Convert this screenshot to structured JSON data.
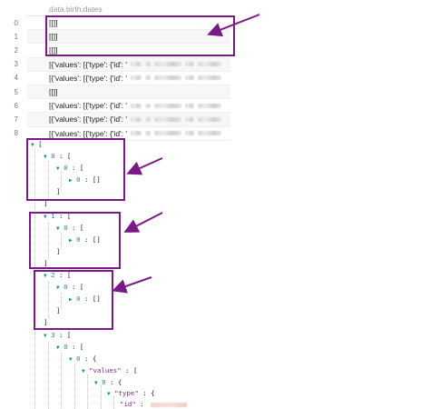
{
  "table": {
    "header": "data.birth.dates",
    "rows": [
      {
        "index": "0",
        "value": "[[]]",
        "blurred": false
      },
      {
        "index": "1",
        "value": "[[]]",
        "blurred": false
      },
      {
        "index": "2",
        "value": "[[]]",
        "blurred": false
      },
      {
        "index": "3",
        "value": "[{'values': [{'type': {'id': '",
        "blurred": true
      },
      {
        "index": "4",
        "value": "[{'values': [{'type': {'id': '",
        "blurred": true
      },
      {
        "index": "5",
        "value": "[[]]",
        "blurred": false
      },
      {
        "index": "6",
        "value": "[{'values': [{'type': {'id': '",
        "blurred": true
      },
      {
        "index": "7",
        "value": "[{'values': [{'type': {'id': '",
        "blurred": true
      },
      {
        "index": "8",
        "value": "[{'values': [{'type': {'id': '",
        "blurred": true
      }
    ]
  },
  "tree": {
    "root_open": "[",
    "item0": {
      "key": "0",
      "open": "[",
      "inner_key": "0",
      "inner_open": "[",
      "leaf_key": "0",
      "leaf_value": "[]",
      "close_inner": "]",
      "close": "]"
    },
    "item1": {
      "key": "1",
      "open": "[",
      "inner_key": "0",
      "inner_open": "[",
      "leaf_key": "0",
      "leaf_value": "[]",
      "close_inner": "]",
      "close": "]"
    },
    "item2": {
      "key": "2",
      "open": "[",
      "inner_key": "0",
      "inner_open": "[",
      "leaf_key": "0",
      "leaf_value": "[]",
      "close_inner": "]",
      "close": "]"
    },
    "item3": {
      "key": "3",
      "open": "[",
      "inner_key": "0",
      "inner_open": "[",
      "obj_key": "0",
      "obj_open": "{",
      "values_key": "\"values\"",
      "values_open": "[",
      "v0_key": "0",
      "v0_open": "{",
      "type_key": "\"type\"",
      "type_open": "{",
      "id_key": "\"id\""
    }
  },
  "colors": {
    "annotation": "#7a1a86",
    "tree_key": "#2a8aa0",
    "triangle": "#1a8f8f"
  }
}
